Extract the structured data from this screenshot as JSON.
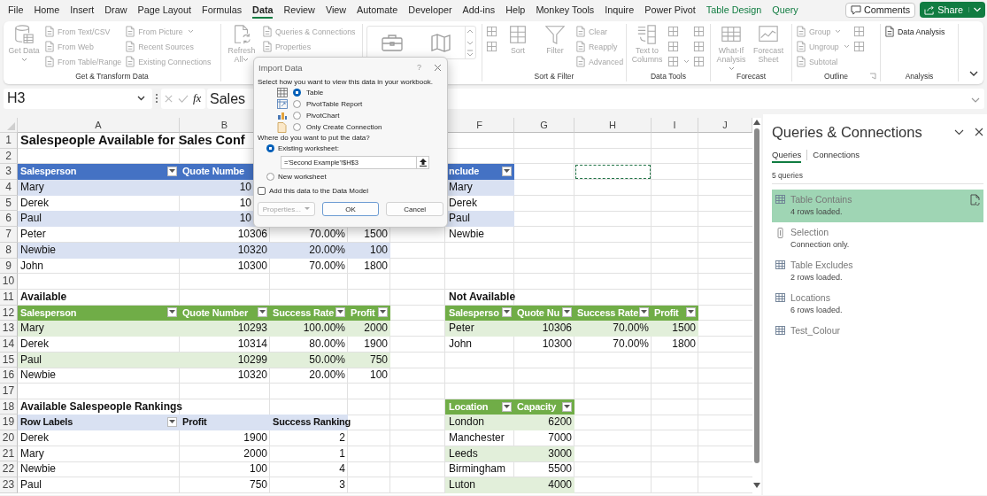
{
  "menu_tabs": [
    {
      "label": "File",
      "selected": false,
      "kind": "plain"
    },
    {
      "label": "Home",
      "selected": false,
      "kind": "plain"
    },
    {
      "label": "Insert",
      "selected": false,
      "kind": "plain"
    },
    {
      "label": "Draw",
      "selected": false,
      "kind": "plain"
    },
    {
      "label": "Page Layout",
      "selected": false,
      "kind": "plain"
    },
    {
      "label": "Formulas",
      "selected": false,
      "kind": "plain"
    },
    {
      "label": "Data",
      "selected": true,
      "kind": "plain"
    },
    {
      "label": "Review",
      "selected": false,
      "kind": "plain"
    },
    {
      "label": "View",
      "selected": false,
      "kind": "plain"
    },
    {
      "label": "Automate",
      "selected": false,
      "kind": "plain"
    },
    {
      "label": "Developer",
      "selected": false,
      "kind": "plain"
    },
    {
      "label": "Add-ins",
      "selected": false,
      "kind": "plain"
    },
    {
      "label": "Help",
      "selected": false,
      "kind": "plain"
    },
    {
      "label": "Monkey Tools",
      "selected": false,
      "kind": "plain"
    },
    {
      "label": "Inquire",
      "selected": false,
      "kind": "plain"
    },
    {
      "label": "Power Pivot",
      "selected": false,
      "kind": "plain"
    },
    {
      "label": "Table Design",
      "selected": false,
      "kind": "contextual"
    },
    {
      "label": "Query",
      "selected": false,
      "kind": "contextual"
    }
  ],
  "comments_button": "Comments",
  "share_button": "Share",
  "ribbon": [
    {
      "kind": "buttons",
      "label": "Get & Transform Data",
      "launcher": false,
      "columns": [
        [
          {
            "label": "Get Data",
            "kind": "large",
            "dropdown": true,
            "disabled": true
          }
        ],
        [
          {
            "label": "From Text/CSV",
            "kind": "small",
            "dropdown": false,
            "disabled": true
          },
          {
            "label": "From Web",
            "kind": "small",
            "dropdown": false,
            "disabled": true
          },
          {
            "label": "From Table/Range",
            "kind": "small",
            "dropdown": false,
            "disabled": true
          }
        ],
        [
          {
            "label": "From Picture",
            "kind": "small",
            "dropdown": true,
            "disabled": true
          },
          {
            "label": "Recent Sources",
            "kind": "small",
            "dropdown": false,
            "disabled": true
          },
          {
            "label": "Existing Connections",
            "kind": "small",
            "dropdown": false,
            "disabled": true
          }
        ]
      ]
    },
    {
      "kind": "buttons",
      "launcher": false,
      "columns": [
        [
          {
            "label": "Refresh All",
            "kind": "large",
            "dropdown": true,
            "disabled": true
          }
        ],
        [
          {
            "label": "Queries & Connections",
            "kind": "small",
            "dropdown": false,
            "disabled": true
          },
          {
            "label": "Properties",
            "kind": "small",
            "dropdown": false,
            "disabled": true
          }
        ]
      ]
    },
    {
      "kind": "gallery"
    },
    {
      "kind": "buttons",
      "label": "Sort & Filter",
      "launcher": false,
      "columns": [
        [
          {
            "kind": "small",
            "dropdown": false,
            "disabled": true
          },
          {
            "kind": "small",
            "dropdown": false,
            "disabled": true
          }
        ],
        [
          {
            "label": "Sort",
            "kind": "large",
            "dropdown": false,
            "disabled": true
          }
        ],
        [
          {
            "label": "Filter",
            "kind": "large",
            "dropdown": false,
            "disabled": true
          }
        ],
        [
          {
            "label": "Clear",
            "kind": "small",
            "dropdown": false,
            "disabled": true
          },
          {
            "label": "Reapply",
            "kind": "small",
            "dropdown": false,
            "disabled": true
          },
          {
            "label": "Advanced",
            "kind": "small",
            "dropdown": false,
            "disabled": true
          }
        ]
      ]
    },
    {
      "kind": "buttons",
      "label": "Data Tools",
      "launcher": false,
      "columns": [
        [
          {
            "label": "Text to Columns",
            "kind": "large",
            "dropdown": false,
            "disabled": true
          }
        ],
        [
          {
            "kind": "small",
            "dropdown": false,
            "disabled": true
          },
          {
            "kind": "small",
            "dropdown": false,
            "disabled": true
          },
          {
            "kind": "small",
            "dropdown": true,
            "disabled": true
          }
        ],
        [
          {
            "kind": "small",
            "dropdown": false,
            "disabled": true
          },
          {
            "kind": "small",
            "dropdown": false,
            "disabled": true
          },
          {
            "kind": "small",
            "dropdown": false,
            "disabled": true
          }
        ]
      ]
    },
    {
      "kind": "buttons",
      "label": "Forecast",
      "launcher": false,
      "columns": [
        [
          {
            "label": "What-If Analysis",
            "kind": "large",
            "dropdown": true,
            "disabled": true
          }
        ],
        [
          {
            "label": "Forecast Sheet",
            "kind": "large",
            "dropdown": false,
            "disabled": true
          }
        ]
      ]
    },
    {
      "kind": "buttons",
      "label": "Outline",
      "launcher": true,
      "columns": [
        [
          {
            "label": "Group",
            "kind": "small",
            "dropdown": true,
            "disabled": true
          },
          {
            "label": "Ungroup",
            "kind": "small",
            "dropdown": true,
            "disabled": true
          },
          {
            "label": "Subtotal",
            "kind": "small",
            "dropdown": false,
            "disabled": true
          }
        ],
        [
          {
            "kind": "small",
            "dropdown": false,
            "disabled": true
          },
          {
            "kind": "small",
            "dropdown": false,
            "disabled": true
          }
        ]
      ]
    },
    {
      "kind": "buttons",
      "label": "Analysis",
      "launcher": false,
      "columns": [
        [
          {
            "label": "Data Analysis",
            "kind": "small",
            "dropdown": false,
            "disabled": false
          }
        ]
      ]
    }
  ],
  "formula_bar": {
    "name_box": "H3",
    "function_label": "fx",
    "formula": "Sales"
  },
  "sheet": {
    "columns": [
      "A",
      "B",
      "F",
      "G",
      "H",
      "I",
      "J"
    ],
    "rows": [
      {
        "number": "1",
        "cells": [
          {
            "kind": "title",
            "text": "Salespeople Available for Sales Conf"
          }
        ]
      },
      {
        "number": "2"
      },
      {
        "number": "3",
        "cells": [
          {
            "kind": "header",
            "text": "Salesperson",
            "color": "#4472c4",
            "filter": true
          },
          {
            "kind": "header",
            "text": "Quote Numbe",
            "color": "#4472c4",
            "filter": false
          },
          {
            "kind": "empty"
          },
          {
            "kind": "empty"
          },
          {
            "kind": "empty"
          },
          {
            "kind": "header",
            "text": "nclude",
            "color": "#4472c4",
            "filter": true
          },
          {
            "kind": "empty"
          },
          {
            "kind": "marquee"
          }
        ]
      },
      {
        "number": "4",
        "cells": [
          {
            "kind": "text",
            "text": "Mary",
            "color": "#d9e1f2"
          },
          {
            "kind": "partial",
            "text": "10",
            "color": "#d9e1f2"
          },
          {
            "kind": "empty"
          },
          {
            "kind": "empty"
          },
          {
            "kind": "empty"
          },
          {
            "kind": "text",
            "text": "Mary",
            "color": "#d9e1f2"
          }
        ]
      },
      {
        "number": "5",
        "cells": [
          {
            "kind": "text",
            "text": "Derek"
          },
          {
            "kind": "partial",
            "text": "10"
          },
          {
            "kind": "empty"
          },
          {
            "kind": "empty"
          },
          {
            "kind": "empty"
          },
          {
            "kind": "text",
            "text": "Derek"
          }
        ]
      },
      {
        "number": "6",
        "cells": [
          {
            "kind": "text",
            "text": "Paul",
            "color": "#d9e1f2"
          },
          {
            "kind": "partial",
            "text": "10",
            "color": "#d9e1f2"
          },
          {
            "kind": "empty"
          },
          {
            "kind": "empty"
          },
          {
            "kind": "empty"
          },
          {
            "kind": "text",
            "text": "Paul",
            "color": "#d9e1f2"
          }
        ]
      },
      {
        "number": "7",
        "cells": [
          {
            "kind": "text",
            "text": "Peter"
          },
          {
            "kind": "number",
            "text": "10306"
          },
          {
            "kind": "number",
            "text": "70.00%"
          },
          {
            "kind": "number",
            "text": "1500"
          },
          {
            "kind": "empty"
          },
          {
            "kind": "text",
            "text": "Newbie"
          }
        ]
      },
      {
        "number": "8",
        "cells": [
          {
            "kind": "text",
            "text": "Newbie",
            "color": "#d9e1f2"
          },
          {
            "kind": "number",
            "text": "10320",
            "color": "#d9e1f2"
          },
          {
            "kind": "number",
            "text": "20.00%",
            "color": "#d9e1f2"
          },
          {
            "kind": "number",
            "text": "100",
            "color": "#d9e1f2"
          }
        ]
      },
      {
        "number": "9",
        "cells": [
          {
            "kind": "text",
            "text": "John"
          },
          {
            "kind": "number",
            "text": "10300"
          },
          {
            "kind": "number",
            "text": "70.00%"
          },
          {
            "kind": "number",
            "text": "1800"
          }
        ]
      },
      {
        "number": "10"
      },
      {
        "number": "11",
        "cells": [
          {
            "kind": "heading",
            "text": "Available"
          },
          {
            "kind": "empty"
          },
          {
            "kind": "empty"
          },
          {
            "kind": "empty"
          },
          {
            "kind": "empty"
          },
          {
            "kind": "heading",
            "text": "Not Available"
          }
        ]
      },
      {
        "number": "12",
        "cells": [
          {
            "kind": "header",
            "text": "Salesperson",
            "color": "#70ad47",
            "filter": true
          },
          {
            "kind": "header",
            "text": "Quote Number",
            "color": "#70ad47",
            "filter": true
          },
          {
            "kind": "header",
            "text": "Success Rate",
            "color": "#70ad47",
            "filter": true
          },
          {
            "kind": "header",
            "text": "Profit",
            "color": "#70ad47",
            "filter": true
          },
          {
            "kind": "empty"
          },
          {
            "kind": "header",
            "text": "Salesperso",
            "color": "#70ad47",
            "filter": true
          },
          {
            "kind": "header",
            "text": "Quote Nu",
            "color": "#70ad47",
            "filter": true
          },
          {
            "kind": "header",
            "text": "Success Rate",
            "color": "#70ad47",
            "filter": true
          },
          {
            "kind": "header",
            "text": "Profit",
            "color": "#70ad47",
            "filter": true
          }
        ]
      },
      {
        "number": "13",
        "cells": [
          {
            "kind": "text",
            "text": "Mary",
            "color": "#e2efda"
          },
          {
            "kind": "number",
            "text": "10293",
            "color": "#e2efda"
          },
          {
            "kind": "number",
            "text": "100.00%",
            "color": "#e2efda"
          },
          {
            "kind": "number",
            "text": "2000",
            "color": "#e2efda"
          },
          {
            "kind": "empty"
          },
          {
            "kind": "text",
            "text": "Peter",
            "color": "#e2efda"
          },
          {
            "kind": "number",
            "text": "10306",
            "color": "#e2efda"
          },
          {
            "kind": "number",
            "text": "70.00%",
            "color": "#e2efda"
          },
          {
            "kind": "number",
            "text": "1500",
            "color": "#e2efda"
          }
        ]
      },
      {
        "number": "14",
        "cells": [
          {
            "kind": "text",
            "text": "Derek"
          },
          {
            "kind": "number",
            "text": "10314"
          },
          {
            "kind": "number",
            "text": "80.00%"
          },
          {
            "kind": "number",
            "text": "1900"
          },
          {
            "kind": "empty"
          },
          {
            "kind": "text",
            "text": "John"
          },
          {
            "kind": "number",
            "text": "10300"
          },
          {
            "kind": "number",
            "text": "70.00%"
          },
          {
            "kind": "number",
            "text": "1800"
          }
        ]
      },
      {
        "number": "15",
        "cells": [
          {
            "kind": "text",
            "text": "Paul",
            "color": "#e2efda"
          },
          {
            "kind": "number",
            "text": "10299",
            "color": "#e2efda"
          },
          {
            "kind": "number",
            "text": "50.00%",
            "color": "#e2efda"
          },
          {
            "kind": "number",
            "text": "750",
            "color": "#e2efda"
          }
        ]
      },
      {
        "number": "16",
        "cells": [
          {
            "kind": "text",
            "text": "Newbie"
          },
          {
            "kind": "number",
            "text": "10320"
          },
          {
            "kind": "number",
            "text": "20.00%"
          },
          {
            "kind": "number",
            "text": "100"
          }
        ]
      },
      {
        "number": "17"
      },
      {
        "number": "18",
        "cells": [
          {
            "kind": "heading",
            "text": "Available Salespeople Rankings"
          },
          {
            "kind": "empty"
          },
          {
            "kind": "empty"
          },
          {
            "kind": "empty"
          },
          {
            "kind": "empty"
          },
          {
            "kind": "header",
            "text": "Location",
            "color": "#70ad47",
            "filter": true
          },
          {
            "kind": "header",
            "text": "Capacity",
            "color": "#70ad47",
            "filter": true
          }
        ]
      },
      {
        "number": "19",
        "cells": [
          {
            "kind": "header",
            "text": "Row Labels",
            "color": "#d9e1f2",
            "filter": true
          },
          {
            "kind": "header",
            "text": "Profit",
            "color": "#d9e1f2",
            "filter": false
          },
          {
            "kind": "header",
            "text": "Success Ranking",
            "color": "#d9e1f2",
            "filter": false
          },
          {
            "kind": "empty"
          },
          {
            "kind": "empty"
          },
          {
            "kind": "text",
            "text": "London",
            "color": "#e2efda"
          },
          {
            "kind": "number",
            "text": "6200",
            "color": "#e2efda"
          }
        ]
      },
      {
        "number": "20",
        "cells": [
          {
            "kind": "text",
            "text": "Derek"
          },
          {
            "kind": "number",
            "text": "1900"
          },
          {
            "kind": "number",
            "text": "2"
          },
          {
            "kind": "empty"
          },
          {
            "kind": "empty"
          },
          {
            "kind": "text",
            "text": "Manchester"
          },
          {
            "kind": "number",
            "text": "7000"
          }
        ]
      },
      {
        "number": "21",
        "cells": [
          {
            "kind": "text",
            "text": "Mary"
          },
          {
            "kind": "number",
            "text": "2000"
          },
          {
            "kind": "number",
            "text": "1"
          },
          {
            "kind": "empty"
          },
          {
            "kind": "empty"
          },
          {
            "kind": "text",
            "text": "Leeds",
            "color": "#e2efda"
          },
          {
            "kind": "number",
            "text": "3000",
            "color": "#e2efda"
          }
        ]
      },
      {
        "number": "22",
        "cells": [
          {
            "kind": "text",
            "text": "Newbie"
          },
          {
            "kind": "number",
            "text": "100"
          },
          {
            "kind": "number",
            "text": "4"
          },
          {
            "kind": "empty"
          },
          {
            "kind": "empty"
          },
          {
            "kind": "text",
            "text": "Birmingham"
          },
          {
            "kind": "number",
            "text": "5500"
          }
        ]
      },
      {
        "number": "23",
        "cells": [
          {
            "kind": "text",
            "text": "Paul"
          },
          {
            "kind": "number",
            "text": "750"
          },
          {
            "kind": "number",
            "text": "3"
          },
          {
            "kind": "empty"
          },
          {
            "kind": "empty"
          },
          {
            "kind": "text",
            "text": "Luton",
            "color": "#e2efda"
          },
          {
            "kind": "number",
            "text": "4000",
            "color": "#e2efda"
          }
        ]
      }
    ]
  },
  "dialog": {
    "title": "Import Data",
    "help": "?",
    "prompt": "Select how you want to view this data in your workbook.",
    "view_options": [
      {
        "label": "Table",
        "selected": true
      },
      {
        "label": "PivotTable Report",
        "selected": false
      },
      {
        "label": "PivotChart",
        "selected": false
      },
      {
        "label": "Only Create Connection",
        "selected": false
      }
    ],
    "location_prompt": "Where do you want to put the data?",
    "location_options": [
      {
        "label": "Existing worksheet:",
        "selected": true,
        "value": "='Second Example'!$H$3"
      },
      {
        "label": "New worksheet",
        "selected": false
      }
    ],
    "data_model": {
      "label": "Add this data to the Data Model",
      "checked": false
    },
    "buttons": [
      {
        "label": "Properties...",
        "kind": "menu",
        "disabled": true
      },
      {
        "label": "OK",
        "kind": "default",
        "disabled": false
      },
      {
        "label": "Cancel",
        "kind": "plain",
        "disabled": false
      }
    ]
  },
  "queries_pane": {
    "title": "Queries & Connections",
    "tabs": [
      {
        "label": "Queries",
        "selected": true
      },
      {
        "label": "Connections",
        "selected": false
      }
    ],
    "count": "5 queries",
    "items": [
      {
        "name": "Table Contains",
        "status": "4 rows loaded.",
        "kind": "table",
        "selected": true
      },
      {
        "name": "Selection",
        "status": "Connection only.",
        "kind": "connection",
        "selected": false
      },
      {
        "name": "Table Excludes",
        "status": "2 rows loaded.",
        "kind": "table",
        "selected": false
      },
      {
        "name": "Locations",
        "status": "6 rows loaded.",
        "kind": "table",
        "selected": false
      },
      {
        "name": "Test_Colour",
        "kind": "table",
        "selected": false
      }
    ]
  }
}
